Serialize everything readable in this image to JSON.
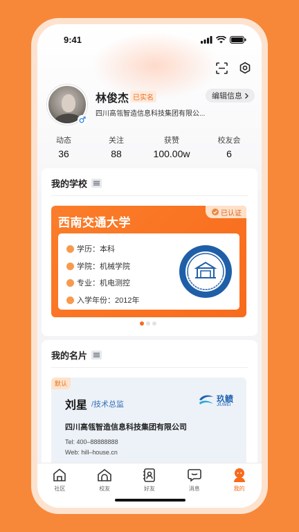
{
  "status_bar": {
    "time": "9:41"
  },
  "profile": {
    "name": "林俊杰",
    "verified_label": "已实名",
    "edit_label": "编辑信息",
    "company": "四川高瓴智造信息科技集团有限公..."
  },
  "stats": [
    {
      "label": "动态",
      "value": "36"
    },
    {
      "label": "关注",
      "value": "88"
    },
    {
      "label": "获赞",
      "value": "100.00w"
    },
    {
      "label": "校友会",
      "value": "6"
    }
  ],
  "school_section": {
    "title": "我的学校",
    "school_name": "西南交通大学",
    "certified_label": "已认证",
    "rows": [
      {
        "icon": "degree-icon",
        "text": "学历：本科"
      },
      {
        "icon": "college-icon",
        "text": "学院：机械学院"
      },
      {
        "icon": "major-icon",
        "text": "专业：机电测控"
      },
      {
        "icon": "year-icon",
        "text": "入学年份：2012年"
      }
    ],
    "pager": {
      "count": 3,
      "active": 0
    }
  },
  "namecard_section": {
    "title": "我的名片",
    "default_tag": "默认",
    "name": "刘星",
    "job_title": "/技术总监",
    "logo_text": "玖鲼",
    "logo_sub": "JIUWEI",
    "company": "四川高瓴智造信息科技集团有限公司",
    "tel": "Tel: 400–88888888",
    "web": "Web: hill–house.cn"
  },
  "tabbar": {
    "items": [
      {
        "label": "社区",
        "icon": "community-icon"
      },
      {
        "label": "校友",
        "icon": "alumni-icon"
      },
      {
        "label": "好友",
        "icon": "friends-icon"
      },
      {
        "label": "消息",
        "icon": "message-icon"
      },
      {
        "label": "我的",
        "icon": "mine-icon",
        "active": true
      }
    ]
  },
  "colors": {
    "accent": "#F76B1C",
    "background": "#F7883A"
  }
}
